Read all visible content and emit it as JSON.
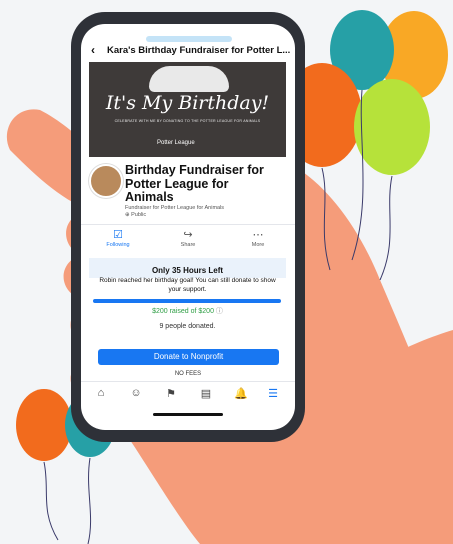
{
  "colors": {
    "accent": "#1877f2",
    "raised_green": "#2e9e44",
    "phone_frame": "#2e3138",
    "skin": "#f59c7a"
  },
  "header": {
    "back_icon": "chevron-left-icon",
    "title": "Kara's Birthday Fundraiser for Potter L..."
  },
  "cover": {
    "title": "It's My Birthday!",
    "subtitle": "CELEBRATE WITH ME BY DONATING TO THE POTTER LEAGUE FOR ANIMALS",
    "logo": "Potter League"
  },
  "fundraiser": {
    "title": "Birthday Fundraiser for Potter League for Animals",
    "subtitle": "Fundraiser for Potter League for Animals",
    "visibility": "Public"
  },
  "actions": [
    {
      "label": "Following",
      "icon": "following-icon"
    },
    {
      "label": "Share",
      "icon": "share-icon"
    },
    {
      "label": "More",
      "icon": "more-icon"
    }
  ],
  "goal": {
    "hours_left": "Only 35 Hours Left",
    "reached_text": "Robin reached her birthday goal! You can still donate to show your support.",
    "raised": "$200 raised of $200",
    "progress": 1.0,
    "donors": "9 people donated."
  },
  "donate": {
    "button": "Donate to Nonprofit",
    "fees": "NO FEES"
  },
  "tabbar": [
    "home-icon",
    "groups-icon",
    "flag-icon",
    "news-icon",
    "bell-icon",
    "menu-icon"
  ]
}
